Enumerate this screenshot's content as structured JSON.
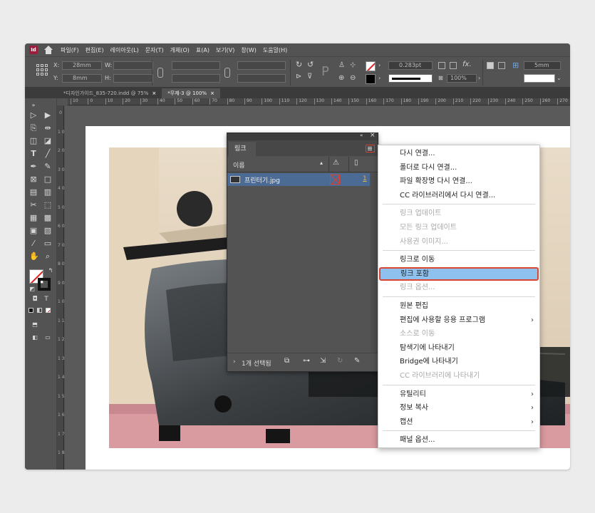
{
  "menubar": {
    "app_icon": "Id",
    "home_icon": "home-icon",
    "items": [
      "파일(F)",
      "편집(E)",
      "레이아웃(L)",
      "문자(T)",
      "개체(O)",
      "표(A)",
      "보기(V)",
      "창(W)",
      "도움말(H)"
    ]
  },
  "control": {
    "x_label": "X:",
    "x_value": "28mm",
    "y_label": "Y:",
    "y_value": "8mm",
    "w_label": "W:",
    "h_label": "H:",
    "stroke_weight": "0.283pt",
    "opacity": "100%",
    "size_value": "5mm"
  },
  "tabs": [
    {
      "label": "*디자인가이드_835-720.indd @ 75%",
      "close": "×",
      "active": false
    },
    {
      "label": "*무제-3 @ 100%",
      "close": "×",
      "active": true
    }
  ],
  "ruler": {
    "h_ticks": [
      "10",
      "0",
      "10",
      "20",
      "30",
      "40",
      "50",
      "60",
      "70",
      "80",
      "90",
      "100",
      "110",
      "120",
      "130",
      "140",
      "150",
      "160",
      "170",
      "180",
      "190",
      "200",
      "210",
      "220",
      "230",
      "240",
      "250",
      "260",
      "270"
    ],
    "v_ticks": [
      "0",
      "1 0",
      "2 0",
      "3 0",
      "4 0",
      "5 0",
      "6 0",
      "7 0",
      "8 0",
      "9 0",
      "1 0 0",
      "1 1 0",
      "1 2 0",
      "1 3 0",
      "1 4 0",
      "1 5 0",
      "1 6 0",
      "1 7 0",
      "1 8 0"
    ]
  },
  "panel": {
    "tab_label": "링크",
    "col_name": "이름",
    "col_warning_icon": "warning-icon",
    "col_page_icon": "page-icon",
    "file_name": "프린터기.jpg",
    "file_page": "1",
    "selection_status": "1개 선택됨",
    "menu_icon": "panel-menu-icon",
    "collapse_icon": "collapse-icon",
    "close_icon": "×"
  },
  "context_menu": {
    "groups": [
      [
        {
          "label": "다시 연결...",
          "disabled": false
        },
        {
          "label": "폴더로 다시 연결...",
          "disabled": false
        },
        {
          "label": "파일 확장명 다시 연결...",
          "disabled": false
        },
        {
          "label": "CC 라이브러리에서 다시 연결...",
          "disabled": false
        }
      ],
      [
        {
          "label": "링크 업데이트",
          "disabled": true
        },
        {
          "label": "모든 링크 업데이트",
          "disabled": true
        },
        {
          "label": "사용권 이미지...",
          "disabled": true
        }
      ],
      [
        {
          "label": "링크로 이동",
          "disabled": false
        },
        {
          "label": "링크 포함",
          "disabled": false,
          "highlighted": true
        },
        {
          "label": "링크 옵션...",
          "disabled": true
        }
      ],
      [
        {
          "label": "원본 편집",
          "disabled": false
        },
        {
          "label": "편집에 사용할 응용 프로그램",
          "disabled": false,
          "submenu": true
        },
        {
          "label": "소스로 이동",
          "disabled": true
        },
        {
          "label": "탐색기에 나타내기",
          "disabled": false
        },
        {
          "label": "Bridge에 나타내기",
          "disabled": false
        },
        {
          "label": "CC 라이브러리에 나타내기",
          "disabled": true
        }
      ],
      [
        {
          "label": "유틸리티",
          "disabled": false,
          "submenu": true
        },
        {
          "label": "정보 복사",
          "disabled": false,
          "submenu": true
        },
        {
          "label": "캡션",
          "disabled": false,
          "submenu": true
        }
      ],
      [
        {
          "label": "패널 옵션...",
          "disabled": false
        }
      ]
    ],
    "submenu_arrow": "›"
  },
  "colors": {
    "highlight": "#8fc1ee",
    "highlight_border": "#d9462f",
    "selected_row": "#4b6b95",
    "app_icon_bg": "#9b1c3c"
  }
}
